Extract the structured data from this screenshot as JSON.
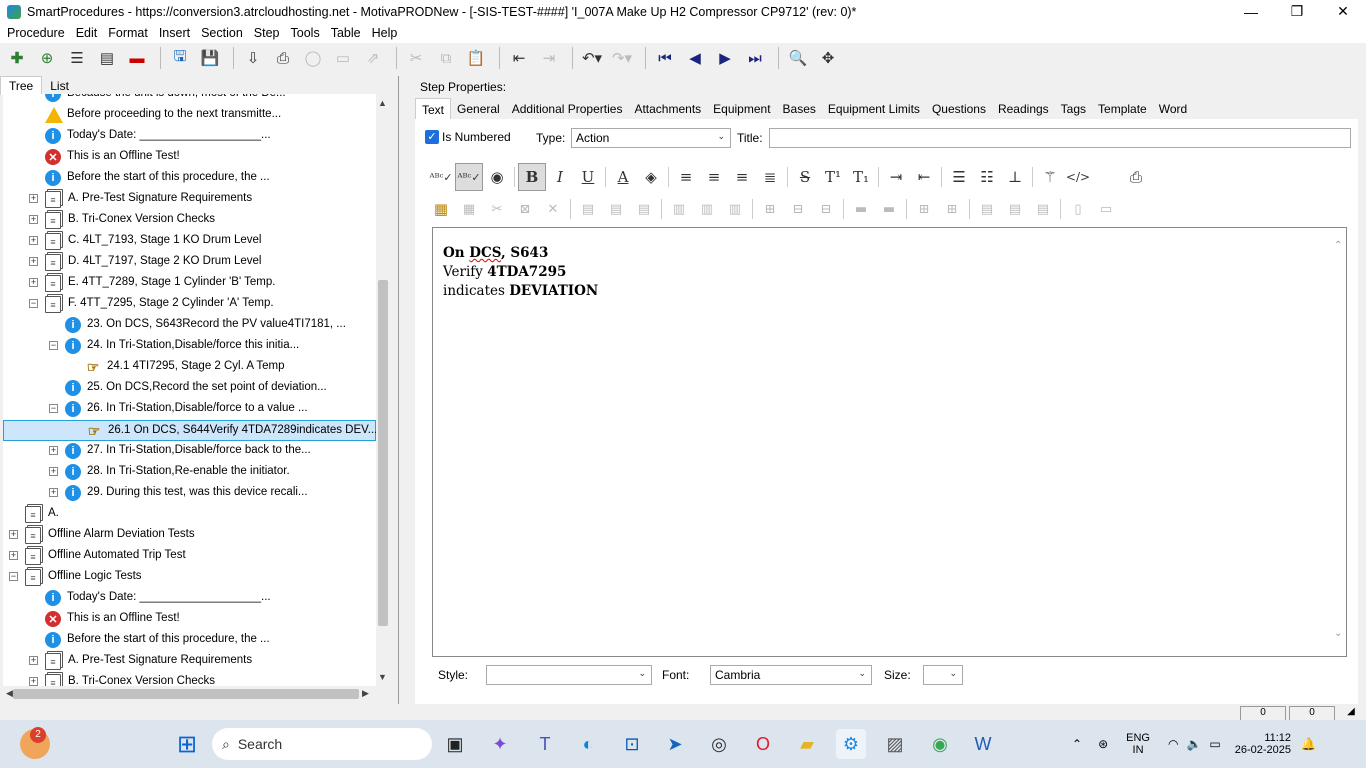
{
  "window": {
    "title": "SmartProcedures - https://conversion3.atrcloudhosting.net - MotivaPRODNew - [-SIS-TEST-####] 'I_007A Make Up H2 Compressor CP9712' (rev: 0)*",
    "minimize": "—",
    "maximize": "❐",
    "close": "✕"
  },
  "menu": [
    "Procedure",
    "Edit",
    "Format",
    "Insert",
    "Section",
    "Step",
    "Tools",
    "Table",
    "Help"
  ],
  "left_tabs": [
    "Tree",
    "List"
  ],
  "tree_rows": [
    {
      "label": "Because the unit is down, most of the De...",
      "icon": "info",
      "exp": ""
    },
    {
      "label": "Before proceeding to the next transmitte...",
      "icon": "warn",
      "exp": ""
    },
    {
      "label": "Today's Date: ___________________...",
      "icon": "info",
      "exp": ""
    },
    {
      "label": "This is an Offline Test!",
      "icon": "err",
      "exp": ""
    },
    {
      "label": "Before the start of this procedure, the ...",
      "icon": "info",
      "exp": ""
    },
    {
      "label": "A. Pre-Test Signature Requirements",
      "icon": "doc",
      "exp": "+"
    },
    {
      "label": "B. Tri-Conex Version Checks",
      "icon": "doc",
      "exp": "+"
    },
    {
      "label": "C. 4LT_7193, Stage 1 KO Drum Level",
      "icon": "doc",
      "exp": "+"
    },
    {
      "label": "D. 4LT_7197, Stage 2 KO Drum Level",
      "icon": "doc",
      "exp": "+"
    },
    {
      "label": "E. 4TT_7289, Stage 1 Cylinder 'B' Temp.",
      "icon": "doc",
      "exp": "+"
    },
    {
      "label": "F. 4TT_7295, Stage 2 Cylinder 'A' Temp.",
      "icon": "doc",
      "exp": "−"
    },
    {
      "label": "23. On DCS, S643Record the PV value4TI7181, ...",
      "icon": "info",
      "exp": ""
    },
    {
      "label": "24. In Tri-Station,Disable/force this initia...",
      "icon": "info",
      "exp": "−"
    },
    {
      "label": "24.1 4TI7295, Stage 2 Cyl. A Temp",
      "icon": "hand",
      "exp": ""
    },
    {
      "label": "25. On DCS,Record the set point of deviation...",
      "icon": "info",
      "exp": ""
    },
    {
      "label": "26. In Tri-Station,Disable/force to a value ...",
      "icon": "info",
      "exp": "−"
    },
    {
      "label": "26.1 On DCS, S644Verify 4TDA7289indicates DEV...",
      "icon": "hand",
      "exp": "",
      "selected": true
    },
    {
      "label": "27. In Tri-Station,Disable/force back to the...",
      "icon": "info",
      "exp": "+"
    },
    {
      "label": "28. In Tri-Station,Re-enable the initiator.",
      "icon": "info",
      "exp": "+"
    },
    {
      "label": "29. During this test, was this device recali...",
      "icon": "info",
      "exp": "+"
    },
    {
      "label": "A.",
      "icon": "doc",
      "exp": ""
    },
    {
      "label": "Offline Alarm Deviation Tests",
      "icon": "doc",
      "exp": "+"
    },
    {
      "label": "Offline Automated Trip Test",
      "icon": "doc",
      "exp": "+"
    },
    {
      "label": "Offline Logic Tests",
      "icon": "doc",
      "exp": "−"
    },
    {
      "label": "Today's Date: ___________________...",
      "icon": "info",
      "exp": ""
    },
    {
      "label": "This is an Offline Test!",
      "icon": "err",
      "exp": ""
    },
    {
      "label": "Before the start of this procedure, the ...",
      "icon": "info",
      "exp": ""
    },
    {
      "label": "A. Pre-Test Signature Requirements",
      "icon": "doc",
      "exp": "+"
    },
    {
      "label": "B. Tri-Conex Version Checks",
      "icon": "doc",
      "exp": "+"
    }
  ],
  "step_properties": {
    "heading": "Step Properties:",
    "tabs": [
      "Text",
      "General",
      "Additional Properties",
      "Attachments",
      "Equipment",
      "Bases",
      "Equipment Limits",
      "Questions",
      "Readings",
      "Tags",
      "Template",
      "Word"
    ],
    "is_numbered_label": "Is Numbered",
    "type_label": "Type:",
    "type_value": "Action",
    "title_label": "Title:",
    "title_value": "",
    "content_lines": [
      {
        "parts": [
          {
            "t": "On ",
            "b": true
          },
          {
            "t": "DCS",
            "b": true,
            "wavy": true
          },
          {
            "t": ", S643",
            "b": true
          }
        ]
      },
      {
        "parts": [
          {
            "t": "Verify ",
            "b": false
          },
          {
            "t": "4TDA7295",
            "b": true
          }
        ]
      },
      {
        "parts": [
          {
            "t": "indicates ",
            "b": false
          },
          {
            "t": "DEVIATION",
            "b": true
          }
        ]
      }
    ],
    "style_label": "Style:",
    "style_value": "",
    "font_label": "Font:",
    "font_value": "Cambria",
    "size_label": "Size:",
    "size_value": ""
  },
  "statusbar": {
    "cell1": "0",
    "cell2": "0"
  },
  "taskbar": {
    "search_placeholder": "Search",
    "notification_count": "2",
    "lang1": "ENG",
    "lang2": "IN",
    "time": "11:12",
    "date": "26-02-2025"
  }
}
